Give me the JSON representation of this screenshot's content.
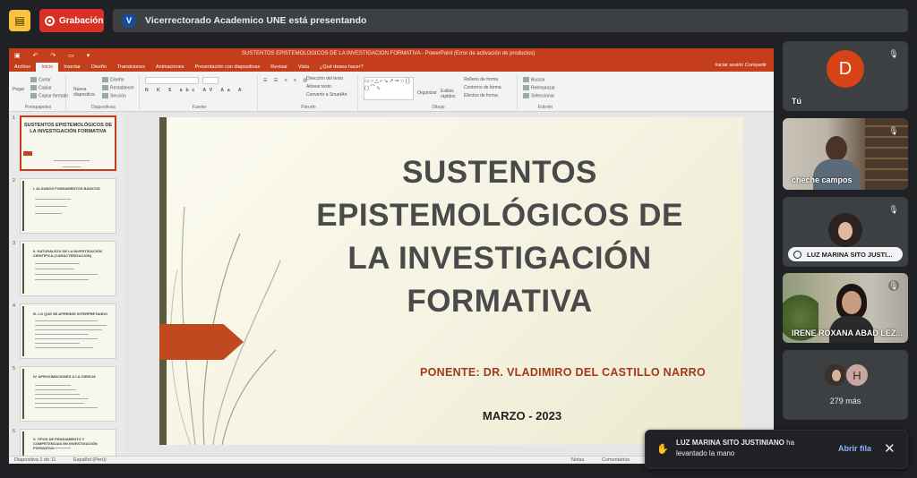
{
  "topbar": {
    "recording_label": "Grabación",
    "presenter_initial": "V",
    "presenting_text": "Vicerrectorado Academico UNE está presentando"
  },
  "powerpoint": {
    "window_title": "SUSTENTOS EPISTEMOLOGICOS DE LA INVESTIGACION FORMATIVA - PowerPoint (Error de activación de productos)",
    "tabs": [
      "Archivo",
      "Inicio",
      "Insertar",
      "Diseño",
      "Transiciones",
      "Animaciones",
      "Presentación con diapositivas",
      "Revisar",
      "Vista",
      "¿Qué desea hacer?"
    ],
    "active_tab": "Inicio",
    "tabs_right": "Iniciar sesión   Compartir",
    "ribbon": {
      "paste": "Pegar",
      "cut": "Cortar",
      "copy": "Copiar",
      "format_painter": "Copiar formato",
      "clipboard_label": "Portapapeles",
      "new_slide": "Nueva diapositiva",
      "layout": "Diseño",
      "reset": "Restablecer",
      "section": "Sección",
      "slides_label": "Diapositivas",
      "font_label": "Fuente",
      "text_direction": "Dirección del texto",
      "align_text": "Alinear texto",
      "convert_smartart": "Convertir a SmartArt",
      "paragraph_label": "Párrafo",
      "arrange": "Organizar",
      "quick_styles": "Estilos rápidos",
      "shape_fill": "Relleno de forma",
      "shape_outline": "Contorno de forma",
      "shape_effects": "Efectos de forma",
      "drawing_label": "Dibujo",
      "find": "Buscar",
      "replace": "Reemplazar",
      "select": "Seleccionar",
      "editing_label": "Edición"
    },
    "thumbnails": [
      {
        "num": "1",
        "title": "SUSTENTOS EPISTEMOLÓGICOS DE LA INVESTIGACIÓN FORMATIVA"
      },
      {
        "num": "2",
        "title": "I. ALGUNOS FUNDAMENTOS BÁSICOS"
      },
      {
        "num": "3",
        "title": "II. NATURALEZA DE LA INVESTIGACIÓN CIENTÍFICA (CARACTERIZACIÓN)"
      },
      {
        "num": "4",
        "title": "III. LO QUE SE APRENDE INTERPRETANDO"
      },
      {
        "num": "5",
        "title": "IV. APROXIMACIONES A LA CIENCIA"
      },
      {
        "num": "6",
        "title": "V. TIPOS DE PENSAMIENTO Y COMPETENCIAS EN INVESTIGACIÓN FORMATIVA"
      }
    ],
    "slide": {
      "title": "SUSTENTOS EPISTEMOLÓGICOS DE LA INVESTIGACIÓN FORMATIVA",
      "presenter": "PONENTE: DR. VLADIMIRO DEL CASTILLO NARRO",
      "date": "MARZO - 2023"
    },
    "status": {
      "slide_counter": "Diapositiva 1 de 11",
      "language": "Español (Perú)",
      "notes": "Notas",
      "comments": "Comentarios"
    }
  },
  "participants": {
    "self": {
      "initial": "D",
      "name": "Tú"
    },
    "p2": {
      "name": "cheche campos"
    },
    "p3": {
      "name": "LUZ MARINA SITO JUSTI..."
    },
    "p4": {
      "name": "IRENE ROXANA ABAD LEZ..."
    },
    "more": {
      "initial": "H",
      "text": "279 más"
    }
  },
  "toast": {
    "text_bold": "LUZ MARINA SITO JUSTINIANO",
    "text_rest": " ha levantado la mano",
    "open_queue": "Abrir fila"
  },
  "colors": {
    "ppt_accent": "#c43e1c",
    "recording": "#d93025",
    "self_avatar": "#d84315",
    "link": "#8ab4f8"
  }
}
